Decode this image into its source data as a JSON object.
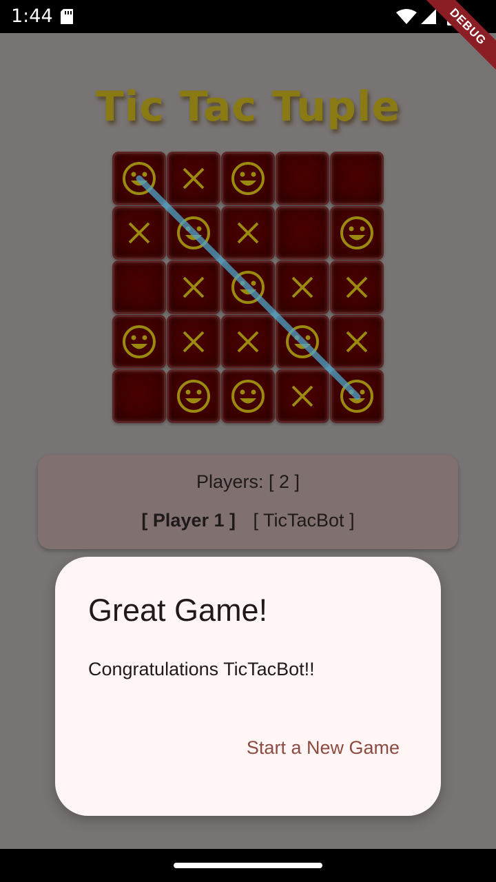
{
  "status_bar": {
    "time": "1:44",
    "icons": [
      "sd-card-icon",
      "wifi-icon",
      "signal-icon",
      "battery-icon"
    ]
  },
  "debug_banner": "DEBUG",
  "game": {
    "title": "Tic Tac Tuple",
    "board": [
      [
        "smiley",
        "x",
        "smiley",
        "",
        ""
      ],
      [
        "x",
        "smiley",
        "x",
        "",
        "smiley"
      ],
      [
        "",
        "x",
        "smiley",
        "x",
        "x"
      ],
      [
        "smiley",
        "x",
        "x",
        "smiley",
        "x"
      ],
      [
        "",
        "smiley",
        "smiley",
        "x",
        "smiley"
      ]
    ],
    "winning_line": "diagonal-top-left-to-bottom-right",
    "players_count": "Players: [ 2 ]",
    "player_1": "[ Player 1 ]",
    "player_2": "[ TicTacBot ]"
  },
  "dialog": {
    "title": "Great Game!",
    "message": "Congratulations TicTacBot!!",
    "action": "Start a New Game"
  },
  "colors": {
    "mark_color": "#9a8a10",
    "cell_bg": "#3d0000",
    "dialog_bg": "#fff6f5",
    "action_color": "#8d4a40",
    "win_line": "#4fa3c9"
  }
}
